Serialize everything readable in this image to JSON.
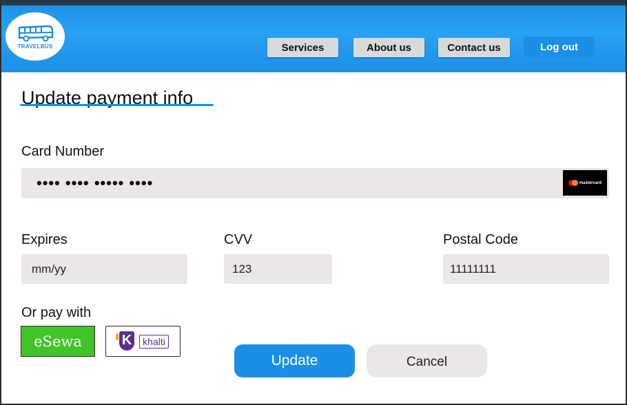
{
  "header": {
    "logo_text": "TRAVELBUS",
    "nav": {
      "services": "Services",
      "about": "About us",
      "contact": "Contact us",
      "logout": "Log out"
    }
  },
  "page": {
    "title": "Update payment info"
  },
  "form": {
    "card_number_label": "Card Number",
    "card_number_value": "•••• •••• ••••• ••••",
    "card_brand": "mastercard",
    "expires_label": "Expires",
    "expires_value": "mm/yy",
    "cvv_label": "CVV",
    "cvv_value": "123",
    "postal_label": "Postal Code",
    "postal_value": "11111111"
  },
  "alt_payment": {
    "label": "Or pay with",
    "esewa": "eSewa",
    "khalti": "khalti"
  },
  "actions": {
    "update": "Update",
    "cancel": "Cancel"
  },
  "colors": {
    "primary": "#1a8fe6",
    "field_bg": "#ece7e7",
    "esewa_green": "#41c427",
    "khalti_purple": "#5c2d91"
  },
  "icons": {
    "logo": "bus-icon",
    "card_brand": "mastercard-icon"
  }
}
